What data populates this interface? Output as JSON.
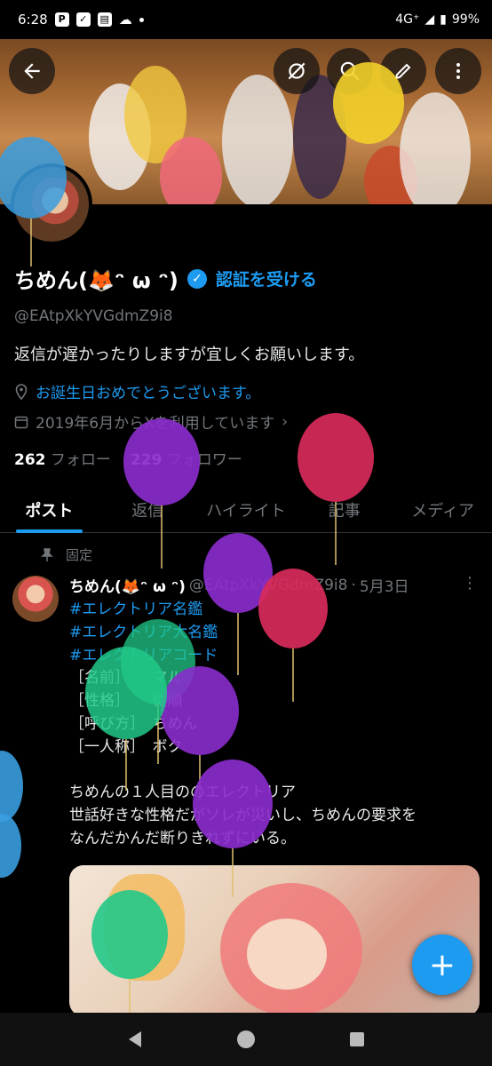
{
  "status_bar": {
    "time": "6:28",
    "network": "4G⁺",
    "battery": "99%"
  },
  "header": {
    "back_icon": "arrow-left-icon",
    "actions": [
      "mute-icon",
      "search-icon",
      "edit-icon",
      "more-vertical-icon"
    ]
  },
  "profile": {
    "name": "ちめん(🦊ᵔ ω ᵔ)",
    "verify_label": "認証を受ける",
    "handle": "@EAtpXkYVGdmZ9i8",
    "bio": "返信が遅かったりしますが宜しくお願いします。",
    "birthday": "お誕生日おめでとうございます。",
    "joined": "2019年6月からXを利用しています",
    "following_count": "262",
    "following_label": "フォロー",
    "followers_count": "229",
    "followers_label": "フォロワー"
  },
  "tabs": [
    {
      "label": "ポスト",
      "active": true
    },
    {
      "label": "返信",
      "active": false
    },
    {
      "label": "ハイライト",
      "active": false
    },
    {
      "label": "記事",
      "active": false
    },
    {
      "label": "メディア",
      "active": false
    }
  ],
  "pinned_post": {
    "pinned_label": "固定",
    "author": "ちめん(🦊ᵔ ω ᵔ)",
    "handle": "@EAtpXkYVGdmZ9i8",
    "date": "5月3日",
    "hashtags": [
      "#エレクトリア名鑑",
      "#エレクトリア大名鑑",
      "#エレクトリアコード"
    ],
    "fields": [
      "［名前］　　マル",
      "［性格］　　従順",
      "［呼び方］　ちめん",
      "［一人称］　ボク"
    ],
    "text_lines": [
      "ちめんの１人目ののエレクトリア",
      "世話好きな性格だがソレが災いし、ちめんの要求を",
      "なんだかんだ断りきれずにいる。"
    ]
  },
  "fab_label": "+",
  "colors": {
    "accent": "#1d9bf0",
    "background": "#000000",
    "muted": "#71767b"
  }
}
